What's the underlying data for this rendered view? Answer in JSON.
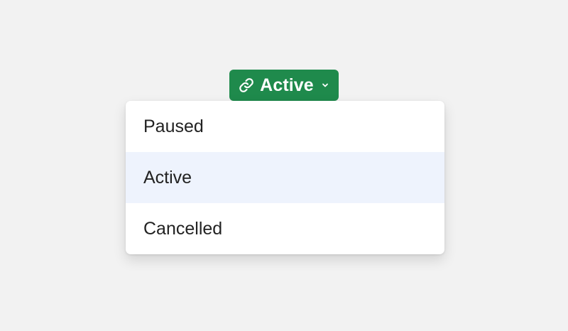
{
  "status_button": {
    "icon": "link-icon",
    "label": "Active",
    "chevron_icon": "chevron-down-icon",
    "color": "#1f8a4c"
  },
  "dropdown": {
    "options": [
      {
        "label": "Paused"
      },
      {
        "label": "Active"
      },
      {
        "label": "Cancelled"
      }
    ],
    "selected_index": 1,
    "highlight_color": "#eef3fd"
  }
}
